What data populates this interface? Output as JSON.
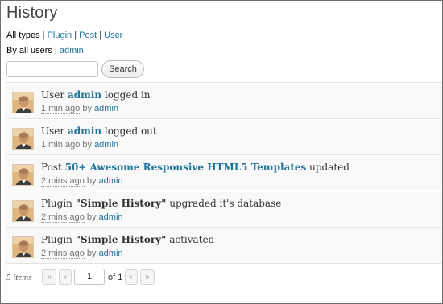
{
  "page": {
    "title": "History"
  },
  "filters": {
    "types": {
      "active": "All types",
      "options": [
        "Plugin",
        "Post",
        "User"
      ],
      "separator": "|"
    },
    "users": {
      "active": "By all users",
      "options": [
        "admin"
      ],
      "separator": "|"
    }
  },
  "search": {
    "placeholder": "",
    "value": "",
    "button_label": "Search"
  },
  "items": [
    {
      "type": "User",
      "object": "admin",
      "object_style": "link",
      "action": "logged in",
      "time": "1 min ago",
      "by": "by",
      "user": "admin"
    },
    {
      "type": "User",
      "object": "admin",
      "object_style": "link",
      "action": "logged out",
      "time": "1 min ago",
      "by": "by",
      "user": "admin"
    },
    {
      "type": "Post",
      "object": "50+ Awesome Responsive HTML5 Templates",
      "object_style": "link",
      "action": "updated",
      "time": "2 mins ago",
      "by": "by",
      "user": "admin"
    },
    {
      "type": "Plugin",
      "object": "\"Simple History\"",
      "object_style": "strong",
      "action": "upgraded it's database",
      "time": "2 mins ago",
      "by": "by",
      "user": "admin"
    },
    {
      "type": "Plugin",
      "object": "\"Simple History\"",
      "object_style": "strong",
      "action": "activated",
      "time": "2 mins ago",
      "by": "by",
      "user": "admin"
    }
  ],
  "pagination": {
    "count_label": "5 items",
    "first": "«",
    "prev": "‹",
    "current_page": "1",
    "of_label": "of 1",
    "next": "›",
    "last": "»"
  },
  "colors": {
    "link": "#21759b",
    "row_bg": "#f9f9f9",
    "border": "#e3e3e3"
  }
}
